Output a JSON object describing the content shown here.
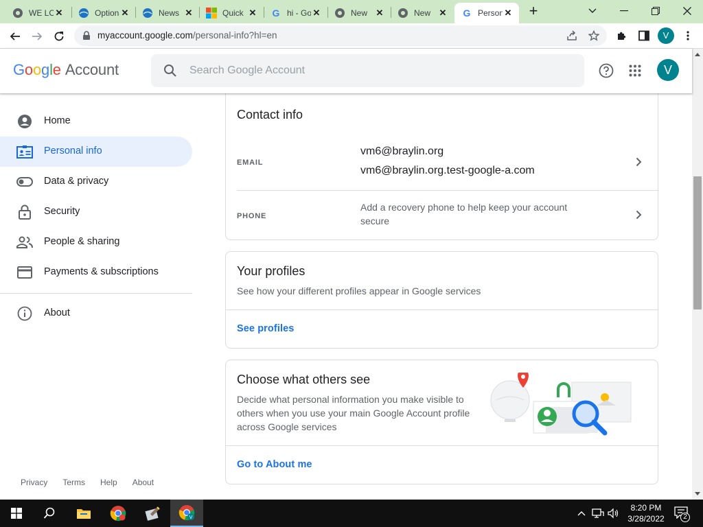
{
  "browser": {
    "tabs": [
      {
        "title": "WE LOOK",
        "icon": "chrome-globe-icon",
        "active": false
      },
      {
        "title": "Options",
        "icon": "edge-globe-icon",
        "active": false
      },
      {
        "title": "News",
        "icon": "edge-globe-icon",
        "active": false
      },
      {
        "title": "Quick",
        "icon": "microsoft-logo-icon",
        "active": false
      },
      {
        "title": "hi - Google",
        "icon": "google-g-icon",
        "active": false
      },
      {
        "title": "New",
        "icon": "chrome-globe-icon",
        "active": false
      },
      {
        "title": "New",
        "icon": "chrome-globe-icon",
        "active": false
      },
      {
        "title": "Personal info",
        "icon": "google-g-icon",
        "active": true
      }
    ],
    "url_host": "myaccount.google.com",
    "url_path": "/personal-info?hl=en",
    "profile_initial": "V"
  },
  "header": {
    "brand_letters": [
      "G",
      "o",
      "o",
      "g",
      "l",
      "e"
    ],
    "brand_product": "Account",
    "search_placeholder": "Search Google Account",
    "avatar_initial": "V"
  },
  "sidebar": {
    "items": [
      {
        "label": "Home",
        "icon": "account-circle-icon",
        "active": false
      },
      {
        "label": "Personal info",
        "icon": "id-card-icon",
        "active": true
      },
      {
        "label": "Data & privacy",
        "icon": "toggle-icon",
        "active": false
      },
      {
        "label": "Security",
        "icon": "lock-icon",
        "active": false
      },
      {
        "label": "People & sharing",
        "icon": "people-icon",
        "active": false
      },
      {
        "label": "Payments & subscriptions",
        "icon": "credit-card-icon",
        "active": false
      }
    ],
    "about": {
      "label": "About",
      "icon": "info-icon"
    },
    "footer": [
      "Privacy",
      "Terms",
      "Help",
      "About"
    ]
  },
  "contact_info": {
    "title": "Contact info",
    "email_label": "EMAIL",
    "emails": [
      "vm6@braylin.org",
      "vm6@braylin.org.test-google-a.com"
    ],
    "phone_label": "PHONE",
    "phone_value": "Add a recovery phone to help keep your account secure"
  },
  "profiles": {
    "title": "Your profiles",
    "subtitle": "See how your different profiles appear in Google services",
    "link": "See profiles"
  },
  "others_see": {
    "title": "Choose what others see",
    "description": "Decide what personal information you make visible to others when you use your main Google Account profile across Google services",
    "link": "Go to About me"
  },
  "taskbar": {
    "time": "8:20 PM",
    "date": "3/28/2022",
    "notification_count": "2"
  },
  "colors": {
    "accent": "#1a73e8",
    "active_nav_bg": "#e8f0fe",
    "avatar": "#00838f",
    "tabstrip": "#cfe8c8"
  }
}
